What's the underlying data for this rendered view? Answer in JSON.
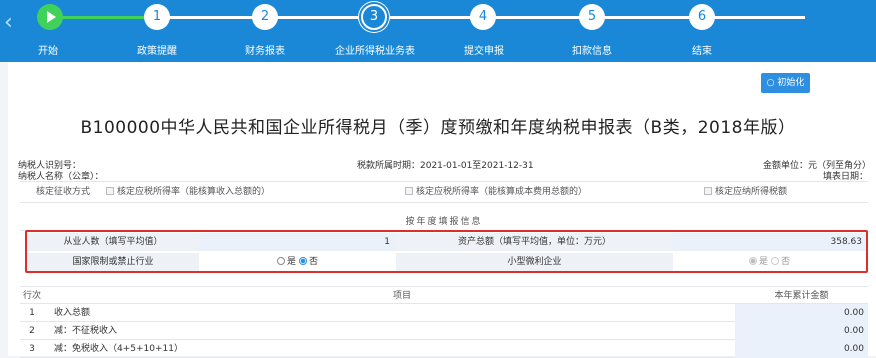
{
  "steps": [
    {
      "num": "",
      "label": "开始",
      "state": "done"
    },
    {
      "num": "1",
      "label": "政策提醒",
      "state": "todo"
    },
    {
      "num": "2",
      "label": "财务报表",
      "state": "todo"
    },
    {
      "num": "3",
      "label": "企业所得税业务表",
      "state": "current"
    },
    {
      "num": "4",
      "label": "提交申报",
      "state": "todo"
    },
    {
      "num": "5",
      "label": "扣款信息",
      "state": "todo"
    },
    {
      "num": "6",
      "label": "结束",
      "state": "todo"
    }
  ],
  "init_button": "初始化",
  "title": "B100000中华人民共和国企业所得税月（季）度预缴和年度纳税申报表（B类，2018年版）",
  "meta": {
    "taxpayer_id": "纳税人识别号：",
    "taxpayer_name": "纳税人名称（公章）：",
    "period": "税款所属时期：2021-01-01至2021-12-31",
    "unit": "金额单位：元（列至角分）",
    "fill_date": "填表日期："
  },
  "approval": {
    "label": "核定征收方式",
    "options": [
      "核定应税所得率（能核算收入总额的）",
      "核定应税所得率（能核算成本费用总额的）",
      "核定应纳所得税额"
    ]
  },
  "annual_section": {
    "title": "按年度填报信息",
    "employees_label": "从业人数（填写平均值）",
    "employees_value": "1",
    "assets_label": "资产总额（填写平均值，单位：万元）",
    "assets_value": "358.63",
    "restricted_label": "国家限制或禁止行业",
    "restricted_yes": "是",
    "restricted_no": "否",
    "small_label": "小型微利企业",
    "small_yes": "是",
    "small_no": "否"
  },
  "table": {
    "headers": [
      "行次",
      "项目",
      "本年累计金额"
    ],
    "rows": [
      {
        "no": "1",
        "item": "收入总额",
        "amount": "0.00"
      },
      {
        "no": "2",
        "item": "减：不征税收入",
        "amount": "0.00"
      },
      {
        "no": "3",
        "item": "减：免税收入（4+5+10+11）",
        "amount": "0.00"
      }
    ]
  }
}
